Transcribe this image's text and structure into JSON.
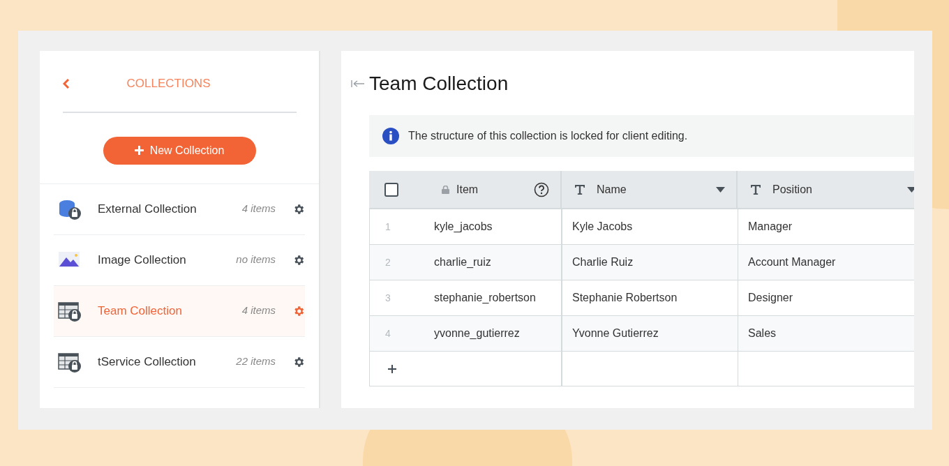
{
  "sidebar": {
    "title": "COLLECTIONS",
    "new_button": "New Collection",
    "items": [
      {
        "kind": "database",
        "label": "External Collection",
        "count": "4 items",
        "selected": false
      },
      {
        "kind": "image",
        "label": "Image Collection",
        "count": "no items",
        "selected": false
      },
      {
        "kind": "table",
        "label": "Team Collection",
        "count": "4 items",
        "selected": true
      },
      {
        "kind": "table",
        "label": "tService Collection",
        "count": "22 items",
        "selected": false
      }
    ]
  },
  "main": {
    "title": "Team Collection",
    "notice": "The structure of this collection is locked for client editing.",
    "table": {
      "select_all_checked": false,
      "columns": [
        {
          "kind": "primary",
          "label": "Item"
        },
        {
          "kind": "text",
          "label": "Name"
        },
        {
          "kind": "text",
          "label": "Position"
        }
      ],
      "rows": [
        {
          "number": "1",
          "cells": [
            "kyle_jacobs",
            "Kyle Jacobs",
            "Manager"
          ]
        },
        {
          "number": "2",
          "cells": [
            "charlie_ruiz",
            "Charlie Ruiz",
            "Account Manager"
          ]
        },
        {
          "number": "3",
          "cells": [
            "stephanie_robertson",
            "Stephanie Robertson",
            "Designer"
          ]
        },
        {
          "number": "4",
          "cells": [
            "yvonne_gutierrez",
            "Yvonne Gutierrez",
            "Sales"
          ]
        }
      ]
    }
  }
}
